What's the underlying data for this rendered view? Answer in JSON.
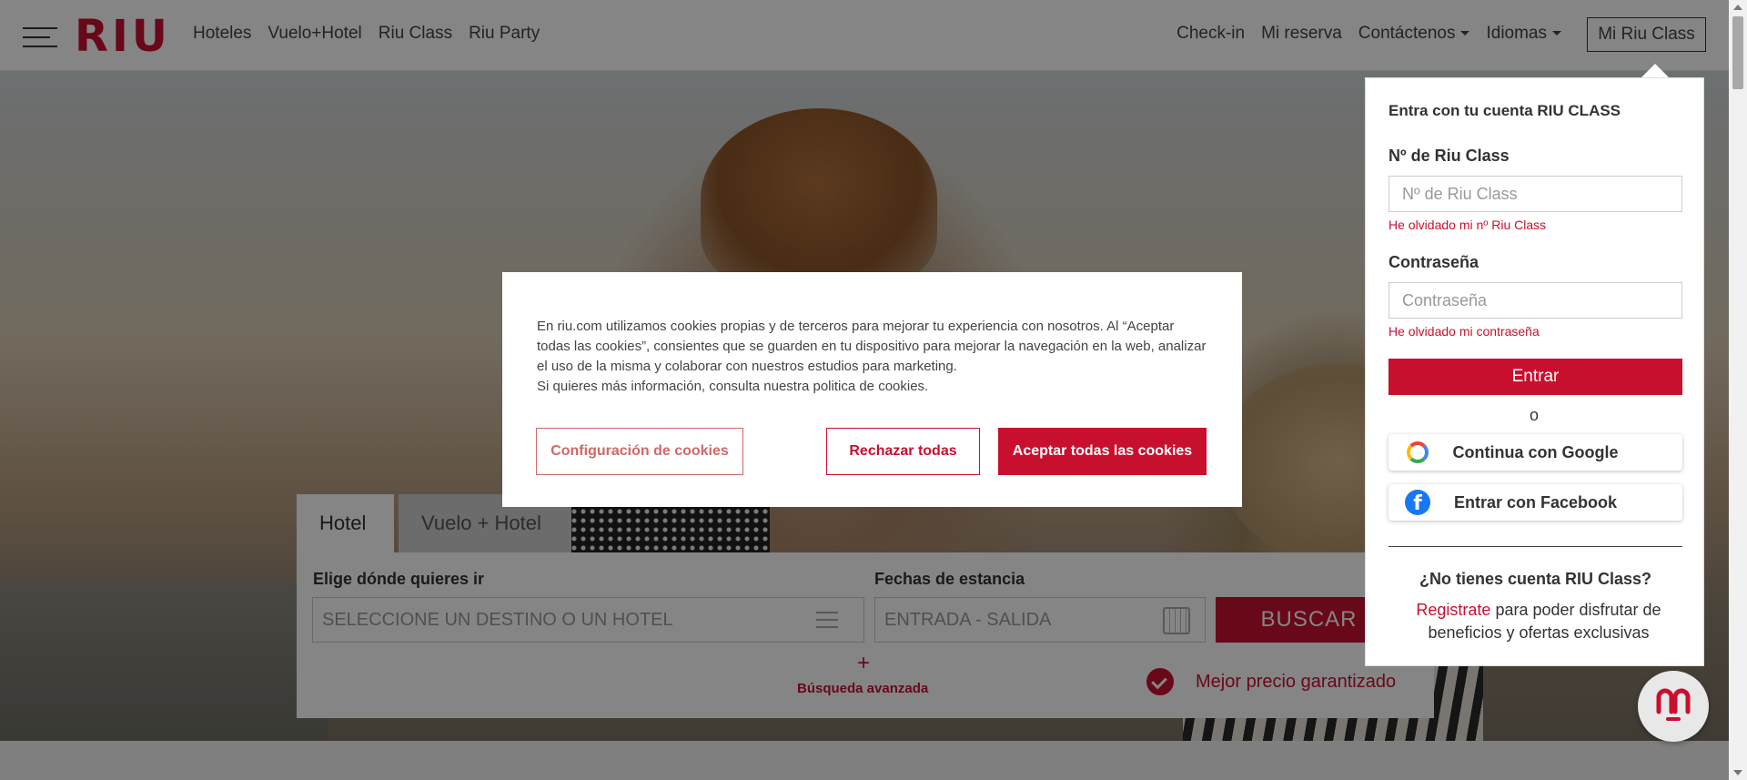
{
  "header": {
    "logo": "RIU",
    "nav_left": [
      "Hoteles",
      "Vuelo+Hotel",
      "Riu Class",
      "Riu Party"
    ],
    "nav_right": {
      "checkin": "Check-in",
      "reserva": "Mi reserva",
      "contacto": "Contáctenos",
      "idiomas": "Idiomas"
    },
    "mi_riu_class": "Mi Riu Class"
  },
  "search": {
    "tabs": [
      "Hotel",
      "Vuelo + Hotel"
    ],
    "destination_label": "Elige dónde quieres ir",
    "destination_placeholder": "SELECCIONE UN DESTINO O UN HOTEL",
    "dates_label": "Fechas de estancia",
    "dates_placeholder": "ENTRADA - SALIDA",
    "search_button": "BUSCAR",
    "advanced_plus": "+",
    "advanced_label": "Búsqueda avanzada",
    "best_price": "Mejor precio garantizado"
  },
  "cookie": {
    "text_1": "En riu.com utilizamos cookies propias y de terceros para mejorar tu experiencia con nosotros. Al “Aceptar todas las cookies”, consientes que se guarden en tu dispositivo para mejorar la navegación en la web, analizar el uso de la misma y colaborar con nuestros estudios para marketing.",
    "text_2": "Si quieres más información, consulta nuestra politica de cookies.",
    "config_button": "Configuración de cookies",
    "reject_button": "Rechazar todas",
    "accept_button": "Aceptar todas las cookies"
  },
  "login": {
    "title": "Entra con tu cuenta RIU CLASS",
    "number_label": "Nº de Riu Class",
    "number_placeholder": "Nº de Riu Class",
    "forgot_number": "He olvidado mi nº Riu Class",
    "password_label": "Contraseña",
    "password_placeholder": "Contraseña",
    "forgot_password": "He olvidado mi contraseña",
    "enter_button": "Entrar",
    "or": "o",
    "google_button": "Continua con Google",
    "facebook_button": "Entrar con Facebook",
    "no_account": "¿No tienes cuenta RIU Class?",
    "register_link": "Registrate",
    "register_text": " para poder disfrutar de beneficios y ofertas exclusivas"
  },
  "icons": {
    "menu": "hamburger-icon",
    "list": "list-icon",
    "calendar": "calendar-icon",
    "check": "check-badge-icon",
    "google": "google-icon",
    "facebook": "facebook-icon",
    "chat": "chat-bot-icon"
  },
  "colors": {
    "brand": "#c8102e",
    "accent_soft": "#d06868",
    "facebook": "#1877f2"
  }
}
